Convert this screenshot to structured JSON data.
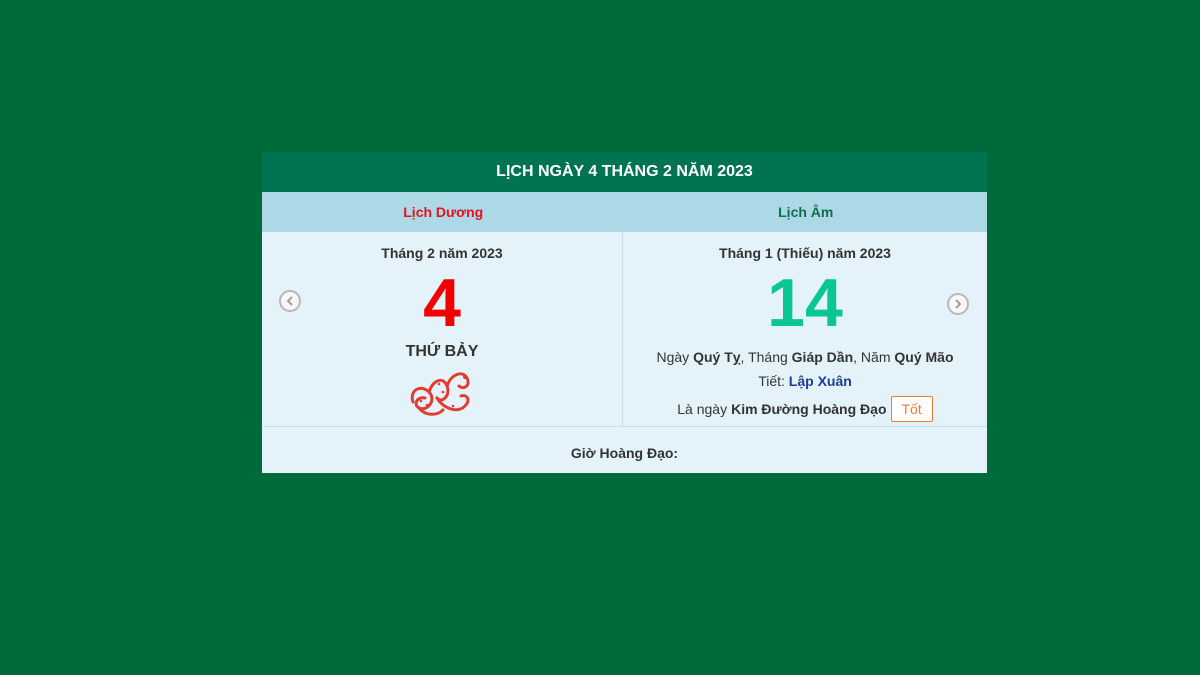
{
  "title": "LỊCH NGÀY 4 THÁNG 2 NĂM 2023",
  "tabs": {
    "solar": "Lịch Dương",
    "lunar": "Lịch Âm"
  },
  "solar": {
    "month_label": "Tháng 2 năm 2023",
    "day": "4",
    "weekday": "THỨ BẢY",
    "zodiac_icon": "snake-icon"
  },
  "lunar": {
    "month_label": "Tháng 1 (Thiếu) năm 2023",
    "day": "14",
    "can_chi": {
      "day_prefix": "Ngày",
      "day_value": "Quý Tỵ",
      "month_prefix": ", Tháng",
      "month_value": "Giáp Dần",
      "year_prefix": ", Năm",
      "year_value": "Quý Mão"
    },
    "solar_term": {
      "label": "Tiết:",
      "value": "Lập Xuân"
    },
    "day_type": {
      "prefix": "Là ngày",
      "value": "Kim Đường Hoàng Đạo",
      "badge": "Tốt"
    }
  },
  "hours": {
    "label": "Giờ Hoàng Đạo:"
  },
  "colors": {
    "background": "#006b3a",
    "title_bar": "#007452",
    "tab_bar": "#add8e6",
    "solar_day": "#f20000",
    "lunar_day": "#0ac693",
    "badge": "#f07b2f"
  }
}
